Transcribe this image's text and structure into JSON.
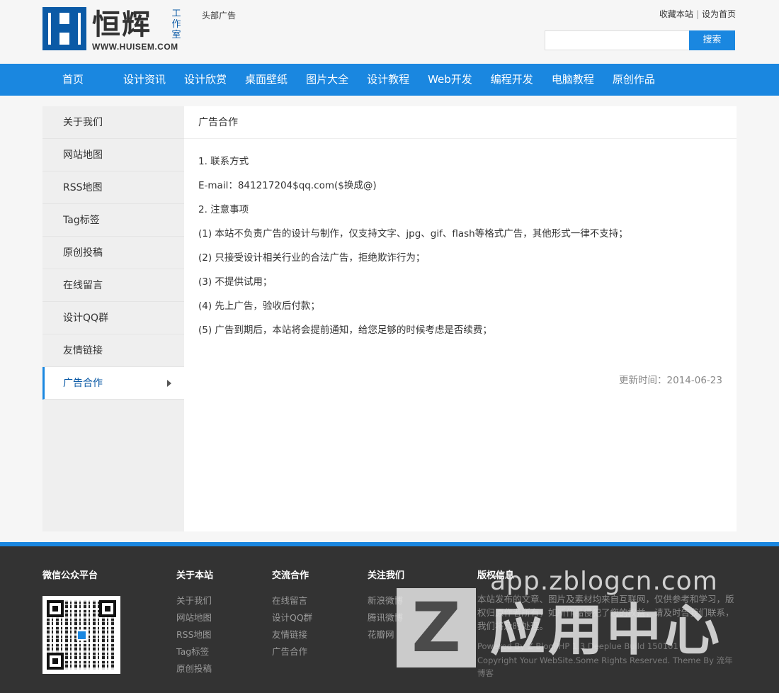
{
  "header": {
    "logo_cn": "恒辉",
    "logo_sub": "工作室",
    "logo_url": "WWW.HUISEM.COM",
    "ad_text": "头部广告",
    "top_links": [
      "收藏本站",
      "设为首页"
    ],
    "search_placeholder": "",
    "search_button": "搜索"
  },
  "nav": {
    "items": [
      "首页",
      "设计资讯",
      "设计欣赏",
      "桌面壁纸",
      "图片大全",
      "设计教程",
      "Web开发",
      "编程开发",
      "电脑教程",
      "原创作品"
    ]
  },
  "sidebar": {
    "items": [
      {
        "label": "关于我们",
        "active": false
      },
      {
        "label": "网站地图",
        "active": false
      },
      {
        "label": "RSS地图",
        "active": false
      },
      {
        "label": "Tag标签",
        "active": false
      },
      {
        "label": "原创投稿",
        "active": false
      },
      {
        "label": "在线留言",
        "active": false
      },
      {
        "label": "设计QQ群",
        "active": false
      },
      {
        "label": "友情链接",
        "active": false
      },
      {
        "label": "广告合作",
        "active": true
      }
    ]
  },
  "content": {
    "title": "广告合作",
    "paragraphs": [
      "1. 联系方式",
      "E-mail：841217204$qq.com($换成@)",
      "2. 注意事项",
      "(1) 本站不负责广告的设计与制作，仅支持文字、jpg、gif、flash等格式广告，其他形式一律不支持；",
      "(2) 只接受设计相关行业的合法广告，拒绝欺诈行为；",
      "(3) 不提供试用；",
      "(4) 先上广告，验收后付款；",
      "(5) 广告到期后，本站将会提前通知，给您足够的时候考虑是否续费；"
    ],
    "update_time": "更新时间：2014-06-23"
  },
  "footer": {
    "wechat_title": "微信公众平台",
    "about_title": "关于本站",
    "about_links": [
      "关于我们",
      "网站地图",
      "RSS地图",
      "Tag标签",
      "原创投稿"
    ],
    "exchange_title": "交流合作",
    "exchange_links": [
      "在线留言",
      "设计QQ群",
      "友情链接",
      "广告合作"
    ],
    "follow_title": "关注我们",
    "follow_links": [
      "新浪微博",
      "腾讯微博",
      "花瓣网"
    ],
    "copyright_title": "版权信息",
    "copyright_text": "本站发布的文章、图片及素材均来自互联网，仅供参考和学习，版权归原作者所有，如所作品侵犯了您的权益，请及时告我们联系，我们将及时处理。",
    "powered": "Powered By Z-BlogPHP 1.3 Deeplue Build 150101",
    "copyright_line": "Copyright Your WebSite.Some Rights Reserved. Theme By 流年博客"
  },
  "watermark": {
    "url": "app.zblogcn.com",
    "letter": "Z",
    "cn": "应用中心"
  },
  "colors": {
    "accent": "#1a87e0",
    "logo_blue": "#0b5aa6",
    "footer_bg": "#333333"
  }
}
